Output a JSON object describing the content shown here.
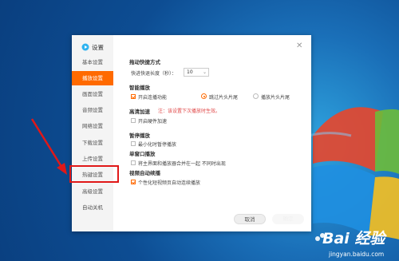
{
  "colors": {
    "accent": "#ff6a00",
    "highlight": "#e01818",
    "warning": "#e04848"
  },
  "dialog": {
    "title": "设置",
    "close_icon": "close-icon",
    "sidebar": [
      {
        "label": "基本设置",
        "active": false
      },
      {
        "label": "播放设置",
        "active": true
      },
      {
        "label": "画面设置",
        "active": false
      },
      {
        "label": "音频设置",
        "active": false
      },
      {
        "label": "网络设置",
        "active": false
      },
      {
        "label": "下载设置",
        "active": false
      },
      {
        "label": "上传设置",
        "active": false
      },
      {
        "label": "热键设置",
        "active": false
      },
      {
        "label": "高级设置",
        "active": false
      },
      {
        "label": "自动关机",
        "active": false
      }
    ],
    "sections": {
      "drag_mode": {
        "title": "拖动快捷方式",
        "label": "快进快退长度（秒）：",
        "value": "10"
      },
      "smart_play": {
        "title": "智能播放",
        "continuous": {
          "label": "开启连播功能",
          "checked": true
        },
        "skip_intro": {
          "label": "跳过片头片尾",
          "selected": true
        },
        "play_intro": {
          "label": "播放片头片尾",
          "selected": false
        }
      },
      "hw_accel": {
        "title": "高清加速",
        "note": "注：该设置下次播放时生效。",
        "enable": {
          "label": "开启硬件加速",
          "checked": false
        }
      },
      "pause_play": {
        "title": "暂停播放",
        "minimize": {
          "label": "最小化时暂停播放",
          "checked": false
        }
      },
      "single_window": {
        "title": "单窗口播放",
        "merge": {
          "label": "将主界面和播放器合并在一起 不同时出现",
          "checked": false
        }
      },
      "video_auto": {
        "title": "视频自动续播",
        "personal": {
          "label": "个性化短视频页自动连续播放",
          "checked": true
        }
      }
    },
    "buttons": {
      "cancel": "取消",
      "ok": "确定"
    }
  },
  "watermark": {
    "text": "Bai 经验",
    "url": "jingyan.baidu.com"
  }
}
